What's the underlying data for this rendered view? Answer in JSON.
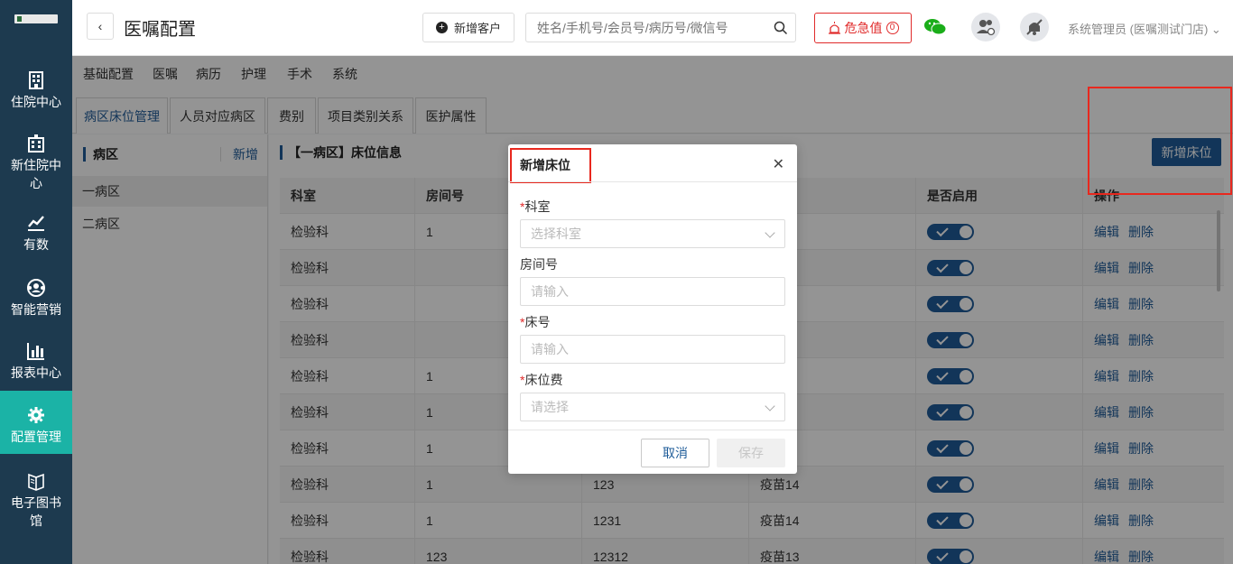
{
  "sidebar": {
    "items": [
      {
        "label": "住院中心",
        "icon": "building-icon"
      },
      {
        "label": "新住院中心",
        "icon": "hospital-icon"
      },
      {
        "label": "有数",
        "icon": "trend-chart-icon"
      },
      {
        "label": "智能营销",
        "icon": "people-network-icon"
      },
      {
        "label": "报表中心",
        "icon": "bar-chart-icon"
      },
      {
        "label": "配置管理",
        "icon": "gear-icon"
      },
      {
        "label": "电子图书馆",
        "icon": "book-icon"
      }
    ],
    "active_index": 5
  },
  "header": {
    "title": "医嘱配置",
    "new_customer": "新增客户",
    "search_placeholder": "姓名/手机号/会员号/病历号/微信号",
    "alert_label": "危急值",
    "alert_count": "0",
    "user": "系统管理员 (医嘱测试门店)"
  },
  "subnav": [
    "基础配置",
    "医嘱",
    "病历",
    "护理",
    "手术",
    "系统"
  ],
  "tabs": [
    "病区床位管理",
    "人员对应病区",
    "费别",
    "项目类别关系",
    "医护属性"
  ],
  "left": {
    "heading": "病区",
    "new": "新增",
    "items": [
      "一病区",
      "二病区"
    ]
  },
  "right": {
    "title": "【一病区】床位信息",
    "add_button": "新增床位",
    "columns": [
      "科室",
      "房间号",
      "",
      "",
      "是否启用",
      "操作"
    ],
    "edit": "编辑",
    "delete": "删除",
    "rows": [
      [
        "检验科",
        "1",
        "",
        ""
      ],
      [
        "检验科",
        "",
        "",
        ""
      ],
      [
        "检验科",
        "",
        "",
        ""
      ],
      [
        "检验科",
        "",
        "",
        ""
      ],
      [
        "检验科",
        "1",
        "",
        ""
      ],
      [
        "检验科",
        "1",
        "",
        ""
      ],
      [
        "检验科",
        "1",
        "",
        ""
      ],
      [
        "检验科",
        "1",
        "123",
        "疫苗14"
      ],
      [
        "检验科",
        "1",
        "1231",
        "疫苗14"
      ],
      [
        "检验科",
        "123",
        "12312",
        "疫苗13"
      ]
    ]
  },
  "dialog": {
    "title": "新增床位",
    "fields": [
      {
        "label": "科室",
        "required": true,
        "placeholder": "选择科室",
        "type": "select"
      },
      {
        "label": "房间号",
        "required": false,
        "placeholder": "请输入",
        "type": "input"
      },
      {
        "label": "床号",
        "required": true,
        "placeholder": "请输入",
        "type": "input"
      },
      {
        "label": "床位费",
        "required": true,
        "placeholder": "请选择",
        "type": "select"
      }
    ],
    "cancel": "取消",
    "save": "保存"
  },
  "colors": {
    "sidebar": "#1d3a4f",
    "active": "#1bb3a6",
    "primary": "#1f5c99",
    "danger": "#e02b2b"
  }
}
